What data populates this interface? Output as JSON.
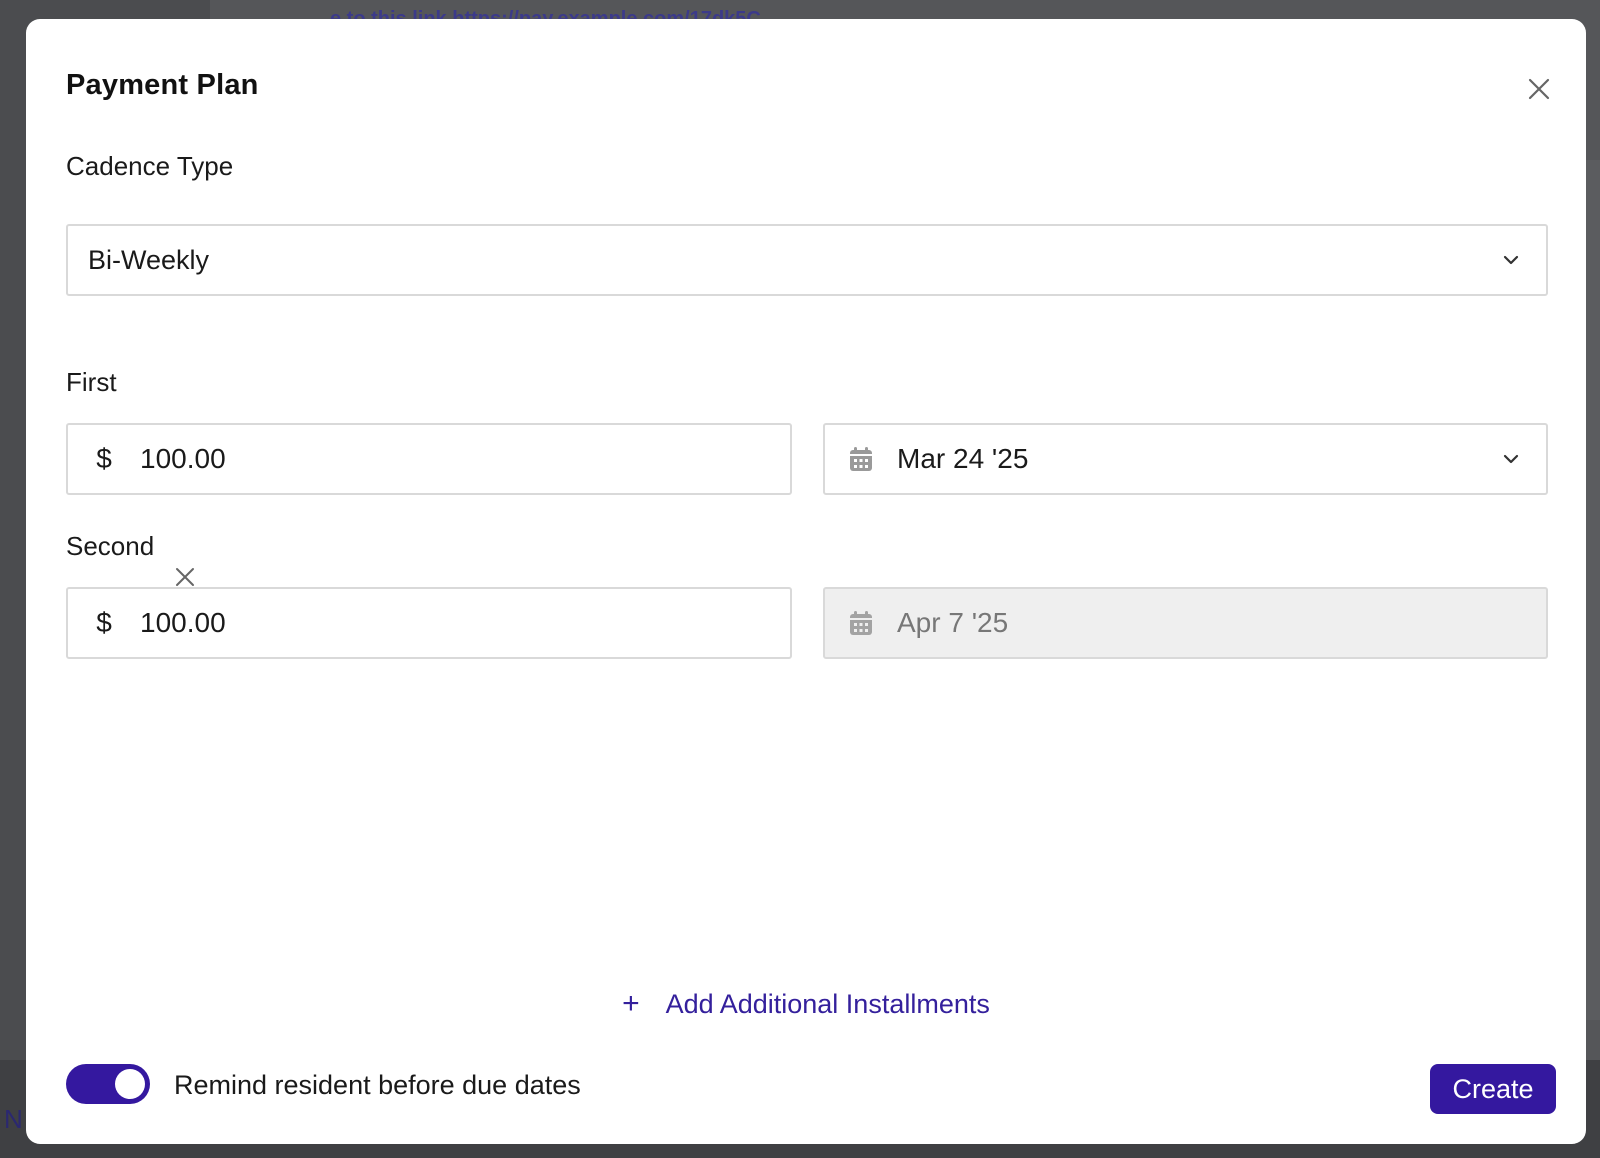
{
  "background": {
    "link_fragment": "e to this link https://pay.example.com/17dk5C",
    "bottom_letter": "N"
  },
  "modal": {
    "title": "Payment Plan",
    "close_icon": "close-icon",
    "cadence": {
      "label": "Cadence Type",
      "value": "Bi-Weekly"
    },
    "installments": [
      {
        "label": "First",
        "currency": "$",
        "amount": "100.00",
        "date": "Mar 24 '25",
        "date_disabled": false,
        "removable": false
      },
      {
        "label": "Second",
        "currency": "$",
        "amount": "100.00",
        "date": "Apr 7 '25",
        "date_disabled": true,
        "removable": true
      }
    ],
    "add_link": {
      "icon": "plus",
      "label": "Add Additional Installments"
    },
    "reminder": {
      "label": "Remind resident before due dates",
      "enabled": true
    },
    "create_label": "Create"
  },
  "colors": {
    "accent": "#34189f",
    "link": "#34209c",
    "border": "#d9d9d9",
    "disabled_bg": "#efefef",
    "overlay": "#4a4b4e"
  }
}
